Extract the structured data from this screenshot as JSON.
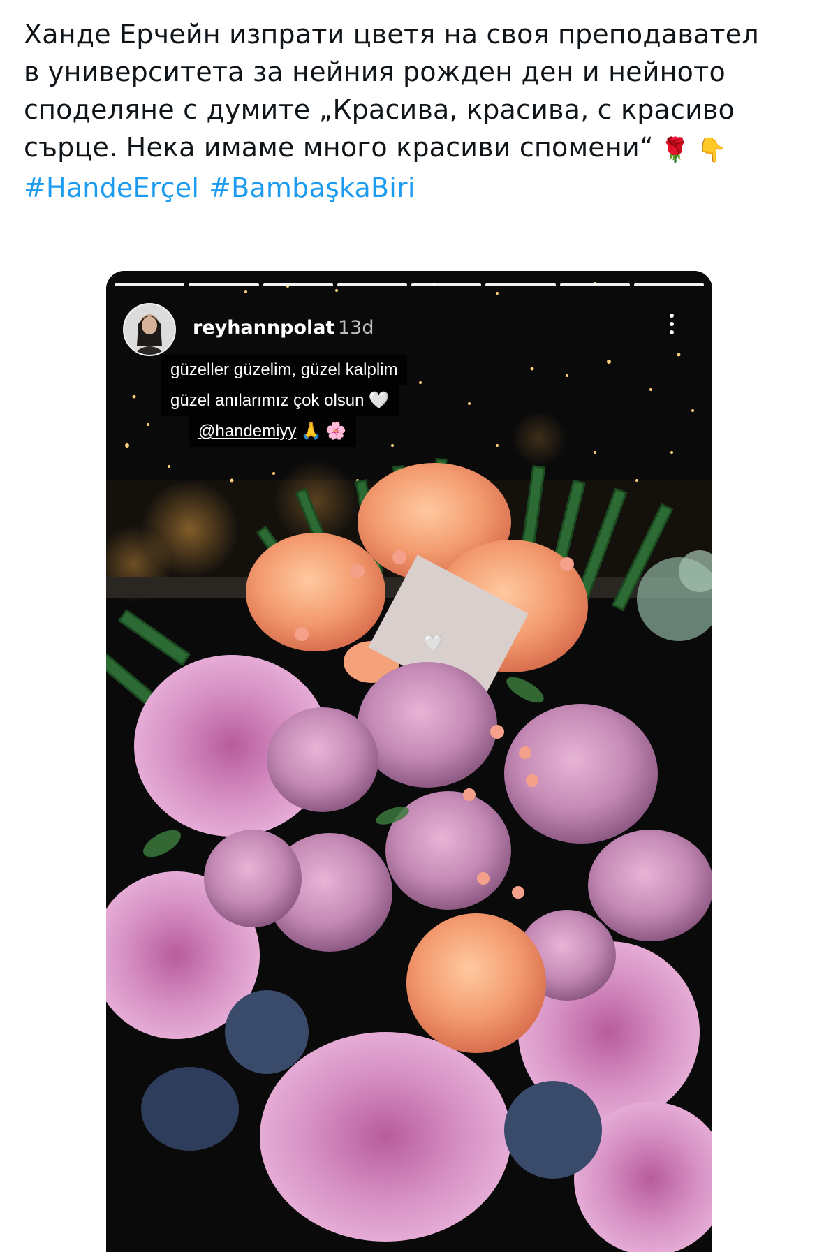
{
  "tweet": {
    "text_lines": [
      "Ханде Ерчейн изпрати цветя на своя преподавател",
      "в университета за нейния рожден ден и нейното",
      "споделяне с думите „Красива, красива, с красиво",
      "сърце. Нека имаме много красиви спомени“"
    ],
    "emojis": [
      "🌹",
      "👇"
    ],
    "hashtags": [
      "#HandeErçel",
      "#BambaşkaBiri"
    ]
  },
  "story": {
    "progress_segments": 8,
    "progress_done": 8,
    "username": "reyhannpolat",
    "time": "13d",
    "caption_lines": [
      "güzeller güzelim, güzel kalplim",
      "güzel anılarımız çok olsun"
    ],
    "caption_line2_emoji": "🤍",
    "mention": "@handemiyy",
    "mention_emojis": [
      "🙏",
      "🌸"
    ],
    "card_emoji": "🤍"
  },
  "colors": {
    "text": "#0f1419",
    "hashtag": "#1d9bf0",
    "story_bg": "#0b0b0c",
    "rose_peach": "#f2a074",
    "rose_lilac": "#c58bb3",
    "chrysanthemum": "#c678b0"
  }
}
